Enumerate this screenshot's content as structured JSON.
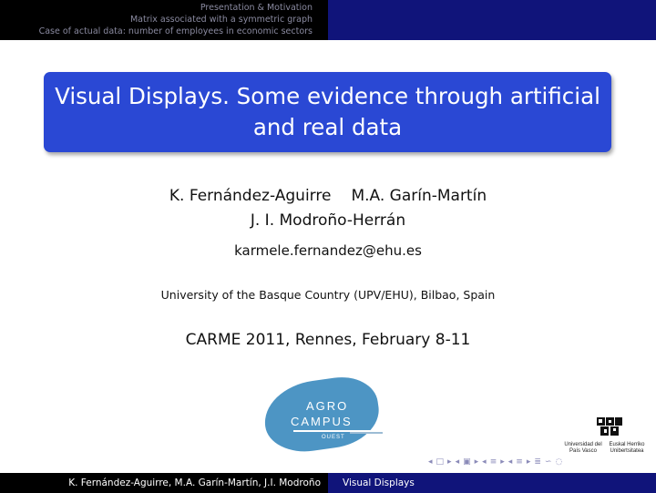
{
  "header": {
    "nav_items": [
      "Presentation & Motivation",
      "Matrix associated with a symmetric graph",
      "Case of actual data: number of employees in economic sectors"
    ]
  },
  "title": "Visual Displays. Some evidence through artificial and real data",
  "authors": {
    "line1_a": "K. Fernández-Aguirre",
    "line1_b": "M.A. Garín-Martín",
    "line2": "J. I. Modroño-Herrán"
  },
  "email": "karmele.fernandez@ehu.es",
  "institution": "University of the Basque Country (UPV/EHU), Bilbao, Spain",
  "conference": "CARME 2011, Rennes, February 8-11",
  "logos": {
    "agro_line1": "AGRO",
    "agro_line2": "CAMPUS",
    "agro_line3": "OUEST",
    "upv_caption": "Universidad del País Vasco",
    "ehu_caption": "Euskal Herriko Unibertsitatea"
  },
  "footer": {
    "authors": "K. Fernández-Aguirre, M.A. Garín-Martín, J.I. Modroño",
    "short_title": "Visual Displays"
  },
  "colors": {
    "title_box": "#2a48d4",
    "bar_dark": "#000000",
    "bar_blue": "#10147a",
    "agro_blue": "#4d95c4"
  }
}
